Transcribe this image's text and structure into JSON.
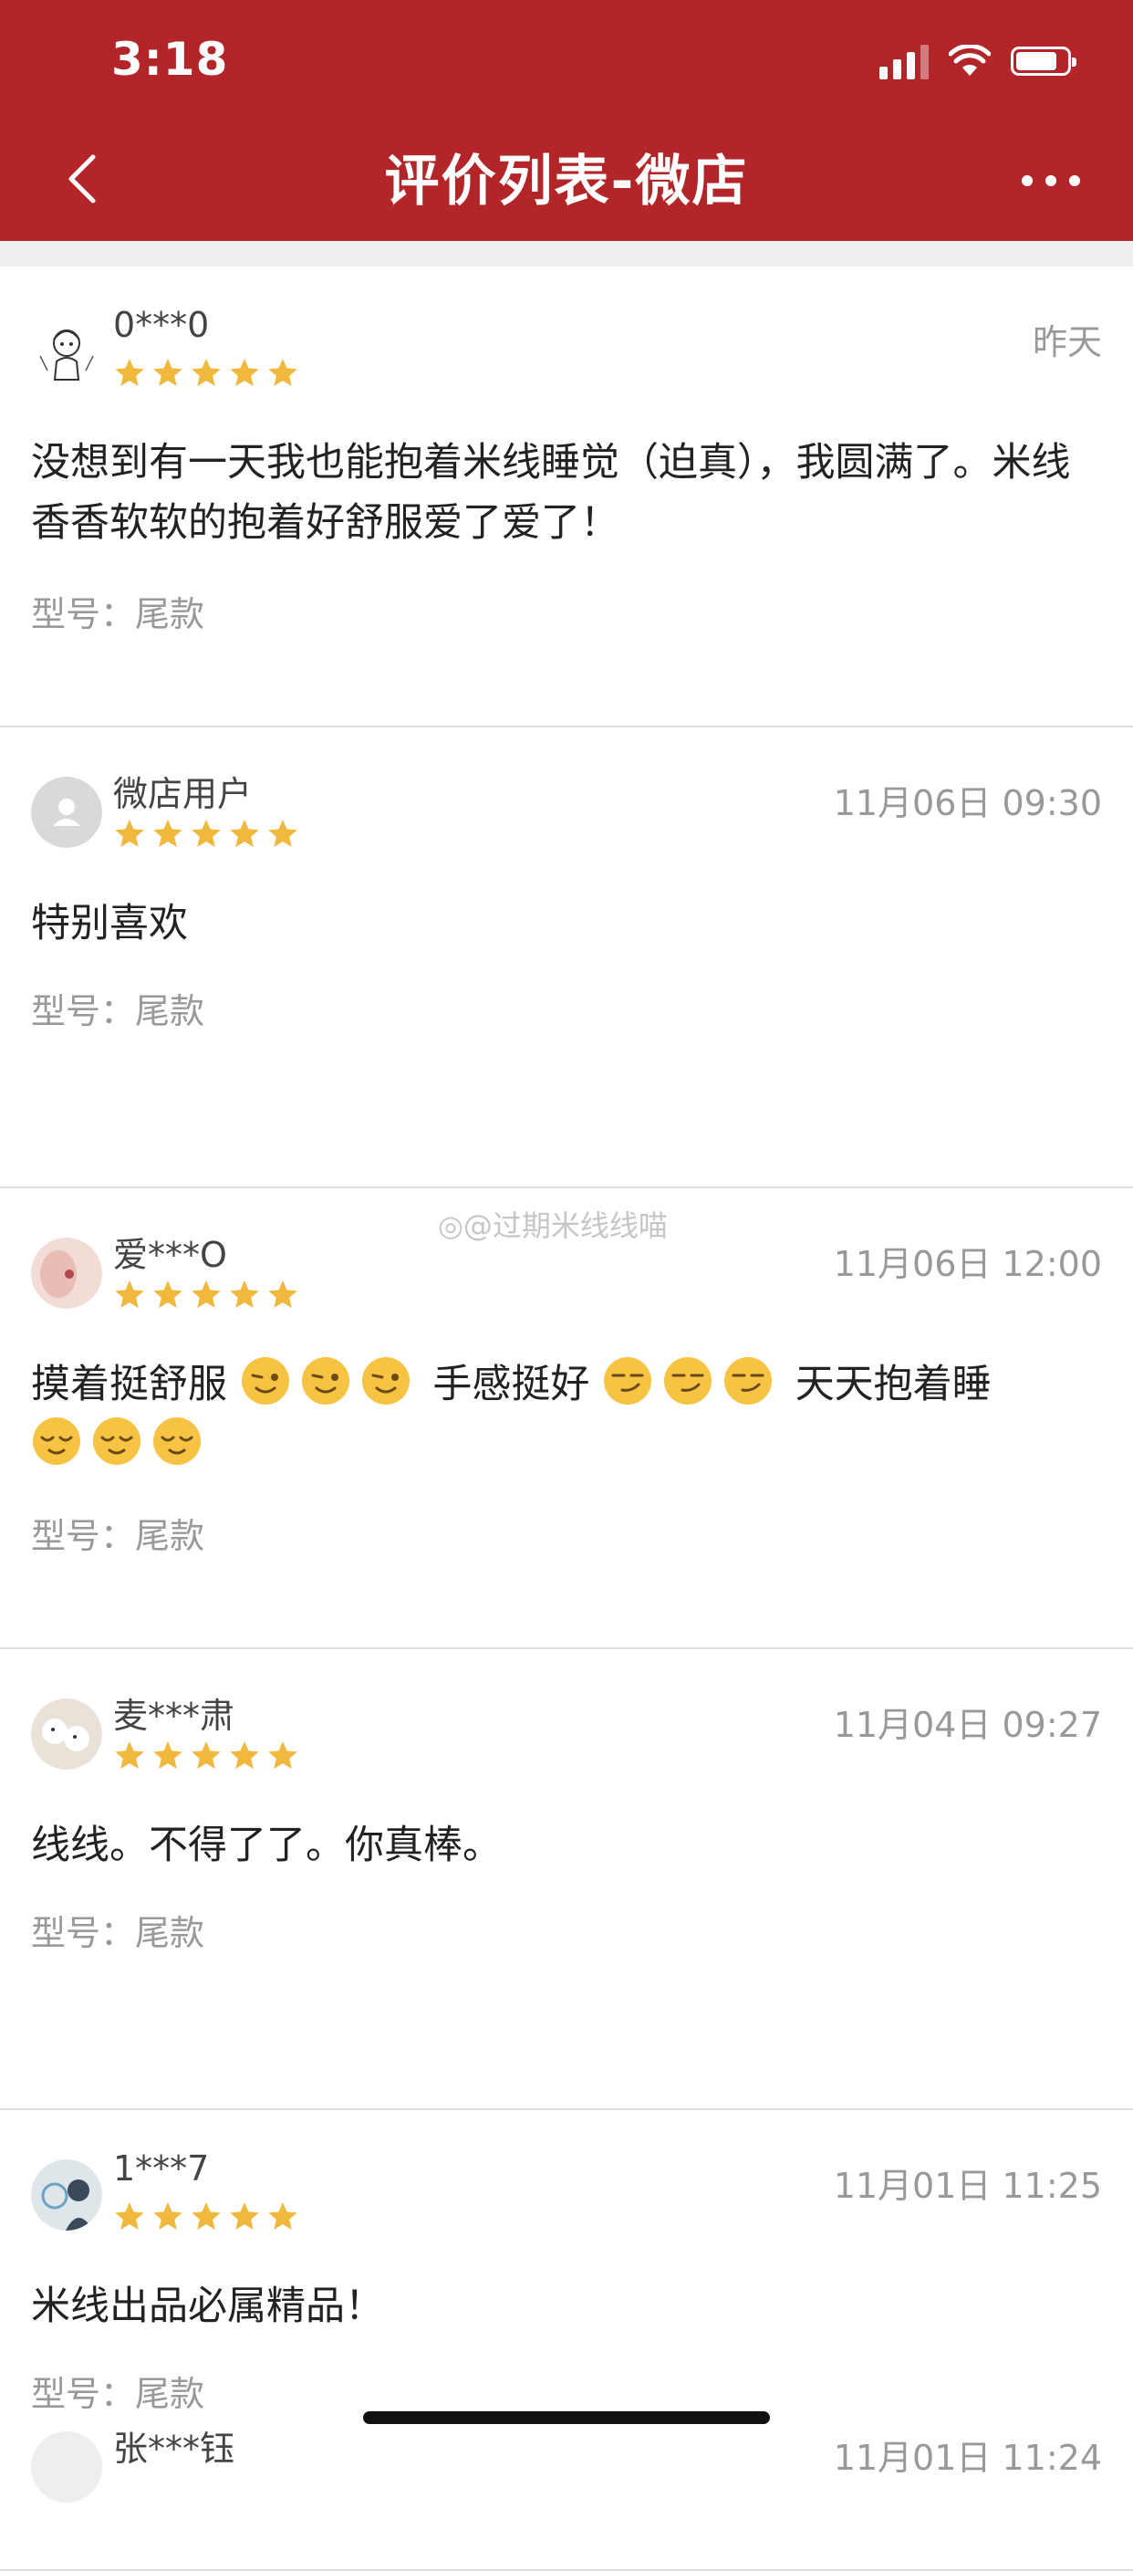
{
  "status_bar": {
    "time": "3:18"
  },
  "nav": {
    "title": "评价列表-微店"
  },
  "reviews": [
    {
      "user": "0***0",
      "time": "昨天",
      "rating": 5,
      "content": "没想到有一天我也能抱着米线睡觉（迫真），我圆满了。米线香香软软的抱着好舒服爱了爱了！",
      "spec": "型号：尾款"
    },
    {
      "user": "微店用户",
      "time": "11月06日 09:30",
      "rating": 5,
      "content": "特别喜欢",
      "spec": "型号：尾款"
    },
    {
      "user": "爱***O",
      "time": "11月06日 12:00",
      "rating": 5,
      "content_parts": [
        "摸着挺舒服",
        "手感挺好",
        "天天抱着睡"
      ],
      "spec": "型号：尾款"
    },
    {
      "user": "麦***肃",
      "time": "11月04日 09:27",
      "rating": 5,
      "content": "线线。不得了了。你真棒。",
      "spec": "型号：尾款"
    },
    {
      "user": "1***7",
      "time": "11月01日 11:25",
      "rating": 5,
      "content": "米线出品必属精品！",
      "spec": "型号：尾款"
    },
    {
      "user": "张***钰",
      "time": "11月01日 11:24"
    }
  ],
  "watermark": "@过期米线线喵",
  "colors": {
    "header": "#b22629",
    "star": "#f0b93e"
  }
}
